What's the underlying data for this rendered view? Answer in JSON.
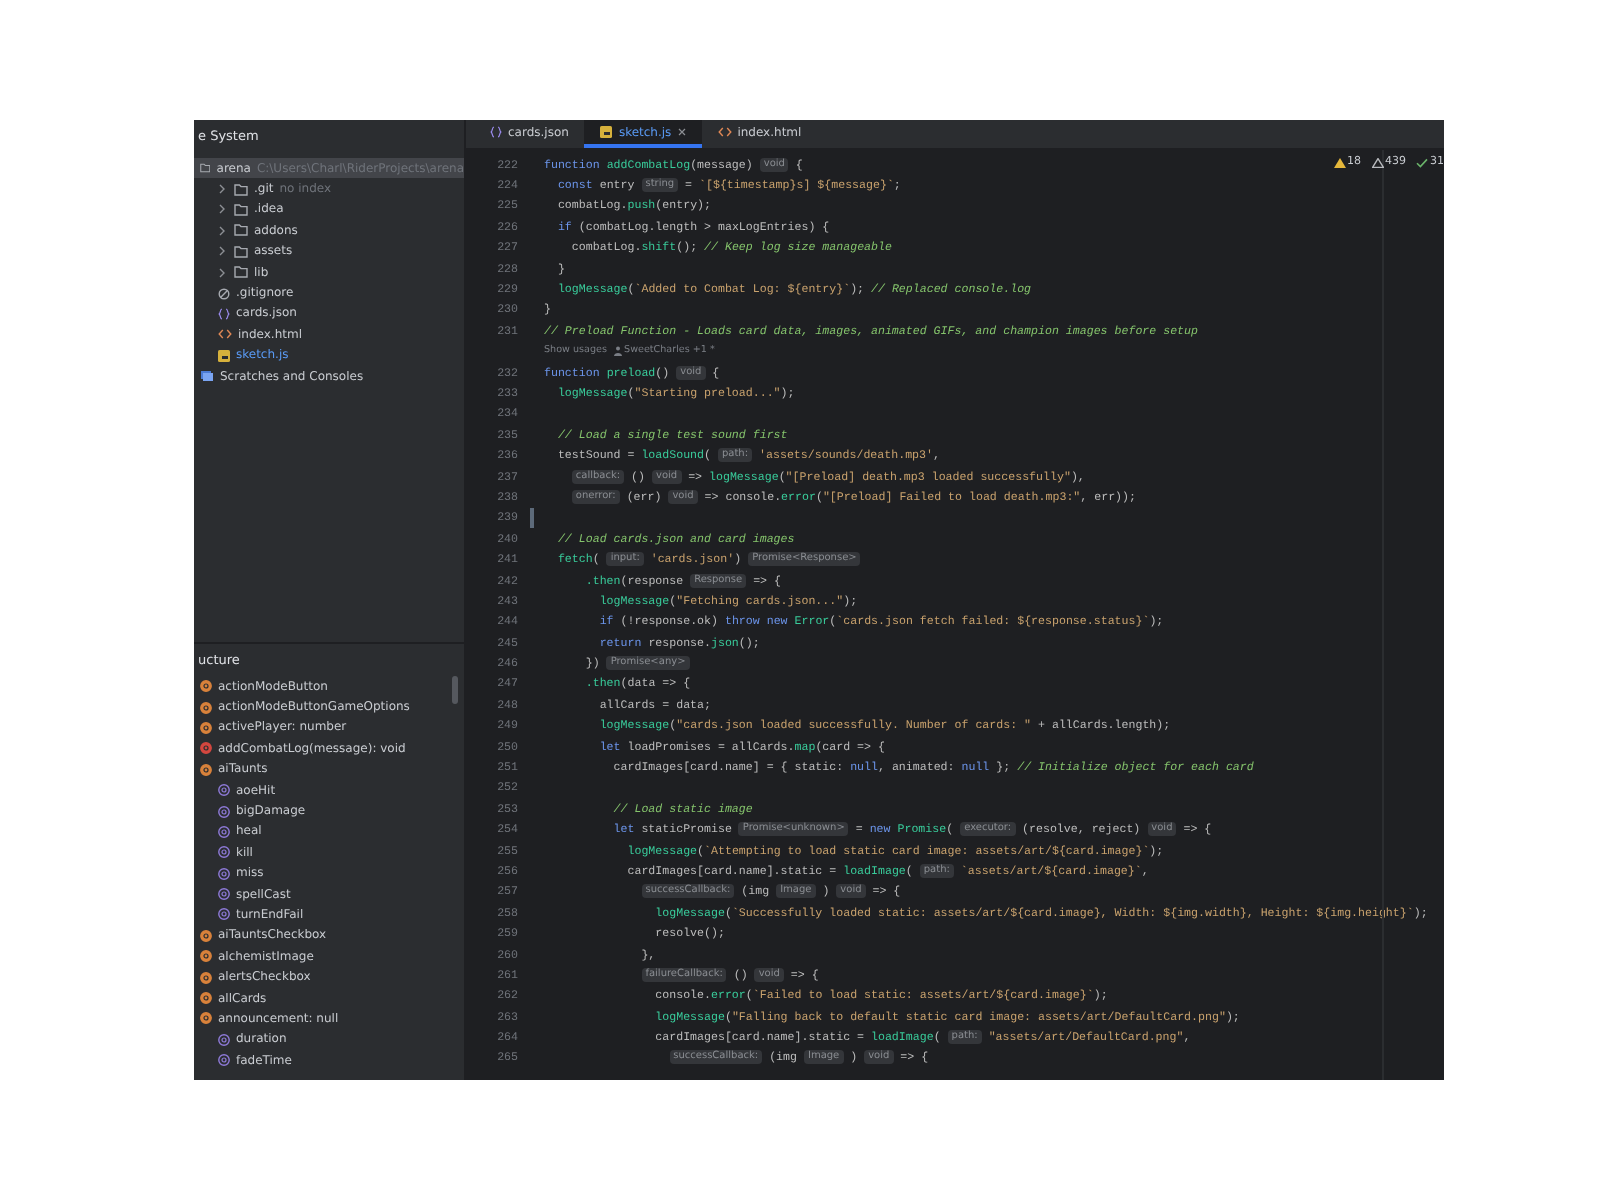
{
  "project_panel": {
    "title": "e System",
    "tree": [
      {
        "kind": "folder",
        "label": "arena",
        "hint": "C:\\Users\\Charl\\RiderProjects\\arena",
        "selected": true,
        "children": [
          {
            "kind": "folder",
            "label": ".git",
            "hint": "no index",
            "expanded": false,
            "selected": false
          },
          {
            "kind": "folder",
            "label": ".idea",
            "expanded": false,
            "selected": false
          },
          {
            "kind": "folder",
            "label": "addons",
            "expanded": false,
            "selected": false
          },
          {
            "kind": "folder",
            "label": "assets",
            "expanded": false,
            "selected": false
          },
          {
            "kind": "folder",
            "label": "lib",
            "expanded": false,
            "selected": false
          },
          {
            "kind": "ignore",
            "label": ".gitignore",
            "selected": false
          },
          {
            "kind": "json",
            "label": "cards.json",
            "selected": false
          },
          {
            "kind": "html",
            "label": "index.html",
            "selected": false
          },
          {
            "kind": "js",
            "label": "sketch.js",
            "selected": false
          }
        ]
      },
      {
        "kind": "scratches",
        "label": "Scratches and Consoles",
        "selected": false
      }
    ]
  },
  "structure_panel": {
    "title": "ucture",
    "items": [
      {
        "kind": "field",
        "label": "actionModeButton"
      },
      {
        "kind": "field",
        "label": "actionModeButtonGameOptions"
      },
      {
        "kind": "field",
        "label": "activePlayer: number"
      },
      {
        "kind": "method",
        "label": "addCombatLog(message): void"
      },
      {
        "kind": "field",
        "label": "aiTaunts",
        "children": [
          {
            "kind": "property",
            "label": "aoeHit"
          },
          {
            "kind": "property",
            "label": "bigDamage"
          },
          {
            "kind": "property",
            "label": "heal"
          },
          {
            "kind": "property",
            "label": "kill"
          },
          {
            "kind": "property",
            "label": "miss"
          },
          {
            "kind": "property",
            "label": "spellCast"
          },
          {
            "kind": "property",
            "label": "turnEndFail"
          }
        ]
      },
      {
        "kind": "field",
        "label": "aiTauntsCheckbox"
      },
      {
        "kind": "field",
        "label": "alchemistImage"
      },
      {
        "kind": "field",
        "label": "alertsCheckbox"
      },
      {
        "kind": "field",
        "label": "allCards"
      },
      {
        "kind": "field",
        "label": "announcement: null",
        "children": [
          {
            "kind": "property",
            "label": "duration"
          },
          {
            "kind": "property",
            "label": "fadeTime"
          }
        ]
      }
    ]
  },
  "tabs": [
    {
      "kind": "json",
      "label": "cards.json",
      "selected": false
    },
    {
      "kind": "js",
      "label": "sketch.js",
      "selected": true,
      "closable": true
    },
    {
      "kind": "html",
      "label": "index.html",
      "selected": false
    }
  ],
  "inspections": [
    {
      "kind": "warning",
      "count": "18"
    },
    {
      "kind": "weak",
      "count": "439"
    },
    {
      "kind": "typo",
      "count": "31"
    }
  ],
  "code_lines": [
    {
      "number": "222",
      "tokens": [
        {
          "kind": "kw",
          "text": "function "
        },
        {
          "kind": "fn",
          "text": "addCombatLog"
        },
        {
          "kind": "plain",
          "text": "(message) "
        },
        {
          "kind": "hint",
          "text": "void"
        },
        {
          "kind": "plain",
          "text": " {"
        }
      ]
    },
    {
      "number": "224",
      "tokens": [
        {
          "kind": "kw",
          "text": "  const "
        },
        {
          "kind": "plain",
          "text": "entry "
        },
        {
          "kind": "hint",
          "text": "string"
        },
        {
          "kind": "plain",
          "text": " = "
        },
        {
          "kind": "str",
          "text": "`[${timestamp}s] ${message}`"
        },
        {
          "kind": "plain",
          "text": ";"
        }
      ]
    },
    {
      "number": "225",
      "tokens": [
        {
          "kind": "plain",
          "text": "  combatLog."
        },
        {
          "kind": "fn",
          "text": "push"
        },
        {
          "kind": "plain",
          "text": "(entry);"
        }
      ]
    },
    {
      "number": "226",
      "tokens": [
        {
          "kind": "kw",
          "text": "  if "
        },
        {
          "kind": "plain",
          "text": "(combatLog.length > maxLogEntries) {"
        }
      ]
    },
    {
      "number": "227",
      "tokens": [
        {
          "kind": "plain",
          "text": "    combatLog."
        },
        {
          "kind": "fn",
          "text": "shift"
        },
        {
          "kind": "plain",
          "text": "(); "
        },
        {
          "kind": "cmt",
          "text": "// Keep log size manageable"
        }
      ]
    },
    {
      "number": "228",
      "tokens": [
        {
          "kind": "plain",
          "text": "  }"
        }
      ]
    },
    {
      "number": "229",
      "tokens": [
        {
          "kind": "fn",
          "text": "  logMessage"
        },
        {
          "kind": "plain",
          "text": "("
        },
        {
          "kind": "str",
          "text": "`Added to Combat Log: ${entry}`"
        },
        {
          "kind": "plain",
          "text": "); "
        },
        {
          "kind": "cmt",
          "text": "// Replaced console.log"
        }
      ]
    },
    {
      "number": "230",
      "tokens": [
        {
          "kind": "plain",
          "text": "}"
        }
      ]
    },
    {
      "number": "231",
      "tokens": [
        {
          "kind": "cmt",
          "text": "// Preload Function - Loads card data, images, animated GIFs, and champion images before setup"
        }
      ]
    },
    {
      "usages": "Show usages",
      "author": "SweetCharles +1 *"
    },
    {
      "number": "232",
      "tokens": [
        {
          "kind": "kw",
          "text": "function "
        },
        {
          "kind": "fn",
          "text": "preload"
        },
        {
          "kind": "plain",
          "text": "() "
        },
        {
          "kind": "hint",
          "text": "void"
        },
        {
          "kind": "plain",
          "text": " {"
        }
      ]
    },
    {
      "number": "233",
      "tokens": [
        {
          "kind": "fn",
          "text": "  logMessage"
        },
        {
          "kind": "plain",
          "text": "("
        },
        {
          "kind": "str",
          "text": "\"Starting preload...\""
        },
        {
          "kind": "plain",
          "text": ");"
        }
      ]
    },
    {
      "number": "234"
    },
    {
      "number": "235",
      "tokens": [
        {
          "kind": "cmt",
          "text": "  // Load a single test sound first"
        }
      ]
    },
    {
      "number": "236",
      "tokens": [
        {
          "kind": "plain",
          "text": "  testSound = "
        },
        {
          "kind": "fn",
          "text": "loadSound"
        },
        {
          "kind": "plain",
          "text": "( "
        },
        {
          "kind": "hint",
          "text": "path:"
        },
        {
          "kind": "str",
          "text": " 'assets/sounds/death.mp3'"
        },
        {
          "kind": "plain",
          "text": ","
        }
      ]
    },
    {
      "number": "237",
      "tokens": [
        {
          "kind": "hint",
          "text": "callback:"
        },
        {
          "kind": "plain",
          "text": " () "
        },
        {
          "kind": "hint",
          "text": "void"
        },
        {
          "kind": "plain",
          "text": " => "
        },
        {
          "kind": "fn",
          "text": "logMessage"
        },
        {
          "kind": "plain",
          "text": "("
        },
        {
          "kind": "str",
          "text": "\"[Preload] death.mp3 loaded successfully\""
        },
        {
          "kind": "plain",
          "text": "),"
        }
      ]
    },
    {
      "number": "238",
      "tokens": [
        {
          "kind": "hint",
          "text": "onerror:"
        },
        {
          "kind": "plain",
          "text": " (err) "
        },
        {
          "kind": "hint",
          "text": "void"
        },
        {
          "kind": "plain",
          "text": " => console."
        },
        {
          "kind": "fn",
          "text": "error"
        },
        {
          "kind": "plain",
          "text": "("
        },
        {
          "kind": "str",
          "text": "\"[Preload] Failed to load death.mp3:\""
        },
        {
          "kind": "plain",
          "text": ", err));"
        }
      ]
    },
    {
      "number": "239",
      "modified": true
    },
    {
      "number": "240",
      "tokens": [
        {
          "kind": "cmt",
          "text": "  // Load cards.json and card images"
        }
      ]
    },
    {
      "number": "241",
      "tokens": [
        {
          "kind": "fn",
          "text": "  fetch"
        },
        {
          "kind": "plain",
          "text": "( "
        },
        {
          "kind": "hint",
          "text": "input:"
        },
        {
          "kind": "str",
          "text": " 'cards.json'"
        },
        {
          "kind": "plain",
          "text": ") "
        },
        {
          "kind": "hint",
          "text": "Promise<Response>"
        }
      ]
    },
    {
      "number": "242",
      "tokens": [
        {
          "kind": "fn",
          "text": "      .then"
        },
        {
          "kind": "plain",
          "text": "(response "
        },
        {
          "kind": "hint",
          "text": "Response"
        },
        {
          "kind": "plain",
          "text": " => {"
        }
      ]
    },
    {
      "number": "243",
      "tokens": [
        {
          "kind": "fn",
          "text": "        logMessage"
        },
        {
          "kind": "plain",
          "text": "("
        },
        {
          "kind": "str",
          "text": "\"Fetching cards.json...\""
        },
        {
          "kind": "plain",
          "text": ");"
        }
      ]
    },
    {
      "number": "244",
      "tokens": [
        {
          "kind": "kw",
          "text": "        if "
        },
        {
          "kind": "plain",
          "text": "(!response.ok) "
        },
        {
          "kind": "kw",
          "text": "throw new "
        },
        {
          "kind": "fn",
          "text": "Error"
        },
        {
          "kind": "plain",
          "text": "("
        },
        {
          "kind": "str",
          "text": "`cards.json fetch failed: ${response.status}`"
        },
        {
          "kind": "plain",
          "text": ");"
        }
      ]
    },
    {
      "number": "245",
      "tokens": [
        {
          "kind": "kw",
          "text": "        return "
        },
        {
          "kind": "plain",
          "text": "response."
        },
        {
          "kind": "fn",
          "text": "json"
        },
        {
          "kind": "plain",
          "text": "();"
        }
      ]
    },
    {
      "number": "246",
      "tokens": [
        {
          "kind": "plain",
          "text": "      }) "
        },
        {
          "kind": "hint",
          "text": "Promise<any>"
        }
      ]
    },
    {
      "number": "247",
      "tokens": [
        {
          "kind": "fn",
          "text": "      .then"
        },
        {
          "kind": "plain",
          "text": "(data => {"
        }
      ]
    },
    {
      "number": "248",
      "tokens": [
        {
          "kind": "plain",
          "text": "        allCards = data;"
        }
      ]
    },
    {
      "number": "249",
      "tokens": [
        {
          "kind": "fn",
          "text": "        logMessage"
        },
        {
          "kind": "plain",
          "text": "("
        },
        {
          "kind": "str",
          "text": "\"cards.json loaded successfully. Number of cards: \""
        },
        {
          "kind": "plain",
          "text": " + allCards.length);"
        }
      ]
    },
    {
      "number": "250",
      "tokens": [
        {
          "kind": "kw",
          "text": "        let "
        },
        {
          "kind": "plain",
          "text": "loadPromises = allCards."
        },
        {
          "kind": "fn",
          "text": "map"
        },
        {
          "kind": "plain",
          "text": "(card => {"
        }
      ]
    },
    {
      "number": "251",
      "tokens": [
        {
          "kind": "plain",
          "text": "          cardImages[card.name] = { static: "
        },
        {
          "kind": "kw",
          "text": "null"
        },
        {
          "kind": "plain",
          "text": ", animated: "
        },
        {
          "kind": "kw",
          "text": "null"
        },
        {
          "kind": "plain",
          "text": " }; "
        },
        {
          "kind": "cmt",
          "text": "// Initialize object for each card"
        }
      ]
    },
    {
      "number": "252"
    },
    {
      "number": "253",
      "tokens": [
        {
          "kind": "cmt",
          "text": "          // Load static image"
        }
      ]
    },
    {
      "number": "254",
      "tokens": [
        {
          "kind": "kw",
          "text": "          let "
        },
        {
          "kind": "plain",
          "text": "staticPromise "
        },
        {
          "kind": "hint",
          "text": "Promise<unknown>"
        },
        {
          "kind": "plain",
          "text": " = "
        },
        {
          "kind": "kw",
          "text": "new "
        },
        {
          "kind": "fn",
          "text": "Promise"
        },
        {
          "kind": "plain",
          "text": "( "
        },
        {
          "kind": "hint",
          "text": "executor:"
        },
        {
          "kind": "plain",
          "text": " (resolve, reject) "
        },
        {
          "kind": "hint",
          "text": "void"
        },
        {
          "kind": "plain",
          "text": " => {"
        }
      ]
    },
    {
      "number": "255",
      "tokens": [
        {
          "kind": "fn",
          "text": "            logMessage"
        },
        {
          "kind": "plain",
          "text": "("
        },
        {
          "kind": "str",
          "text": "`Attempting to load static card image: assets/art/${card.image}`"
        },
        {
          "kind": "plain",
          "text": ");"
        }
      ]
    },
    {
      "number": "256",
      "tokens": [
        {
          "kind": "plain",
          "text": "            cardImages[card.name].static = "
        },
        {
          "kind": "fn",
          "text": "loadImage"
        },
        {
          "kind": "plain",
          "text": "( "
        },
        {
          "kind": "hint",
          "text": "path:"
        },
        {
          "kind": "str",
          "text": " `assets/art/${card.image}`"
        },
        {
          "kind": "plain",
          "text": ","
        }
      ]
    },
    {
      "number": "257",
      "tokens": [
        {
          "kind": "hint",
          "text": "successCallback:"
        },
        {
          "kind": "plain",
          "text": " (img "
        },
        {
          "kind": "hint",
          "text": "Image"
        },
        {
          "kind": "plain",
          "text": " ) "
        },
        {
          "kind": "hint",
          "text": "void"
        },
        {
          "kind": "plain",
          "text": " => {"
        }
      ]
    },
    {
      "number": "258",
      "tokens": [
        {
          "kind": "fn",
          "text": "                logMessage"
        },
        {
          "kind": "plain",
          "text": "("
        },
        {
          "kind": "str",
          "text": "`Successfully loaded static: assets/art/${card.image}, Width: ${img.width}, Height: ${img.height}`"
        },
        {
          "kind": "plain",
          "text": ");"
        }
      ]
    },
    {
      "number": "259",
      "tokens": [
        {
          "kind": "plain",
          "text": "                resolve();"
        }
      ]
    },
    {
      "number": "260",
      "tokens": [
        {
          "kind": "plain",
          "text": "              },"
        }
      ]
    },
    {
      "number": "261",
      "tokens": [
        {
          "kind": "hint",
          "text": "failureCallback:"
        },
        {
          "kind": "plain",
          "text": " () "
        },
        {
          "kind": "hint",
          "text": "void"
        },
        {
          "kind": "plain",
          "text": " => {"
        }
      ]
    },
    {
      "number": "262",
      "tokens": [
        {
          "kind": "plain",
          "text": "                console."
        },
        {
          "kind": "fn",
          "text": "error"
        },
        {
          "kind": "plain",
          "text": "("
        },
        {
          "kind": "str",
          "text": "`Failed to load static: assets/art/${card.image}`"
        },
        {
          "kind": "plain",
          "text": ");"
        }
      ]
    },
    {
      "number": "263",
      "tokens": [
        {
          "kind": "fn",
          "text": "                logMessage"
        },
        {
          "kind": "plain",
          "text": "("
        },
        {
          "kind": "str",
          "text": "\"Falling back to default static card image: assets/art/DefaultCard.png\""
        },
        {
          "kind": "plain",
          "text": ");"
        }
      ]
    },
    {
      "number": "264",
      "tokens": [
        {
          "kind": "plain",
          "text": "                cardImages[card.name].static = "
        },
        {
          "kind": "fn",
          "text": "loadImage"
        },
        {
          "kind": "plain",
          "text": "( "
        },
        {
          "kind": "hint",
          "text": "path:"
        },
        {
          "kind": "str",
          "text": " \"assets/art/DefaultCard.png\""
        },
        {
          "kind": "plain",
          "text": ","
        }
      ]
    },
    {
      "number": "265",
      "tokens": [
        {
          "kind": "hint",
          "text": "successCallback:"
        },
        {
          "kind": "plain",
          "text": " (img "
        },
        {
          "kind": "hint",
          "text": "Image"
        },
        {
          "kind": "plain",
          "text": " ) "
        },
        {
          "kind": "hint",
          "text": "void"
        },
        {
          "kind": "plain",
          "text": " => {"
        }
      ]
    }
  ]
}
